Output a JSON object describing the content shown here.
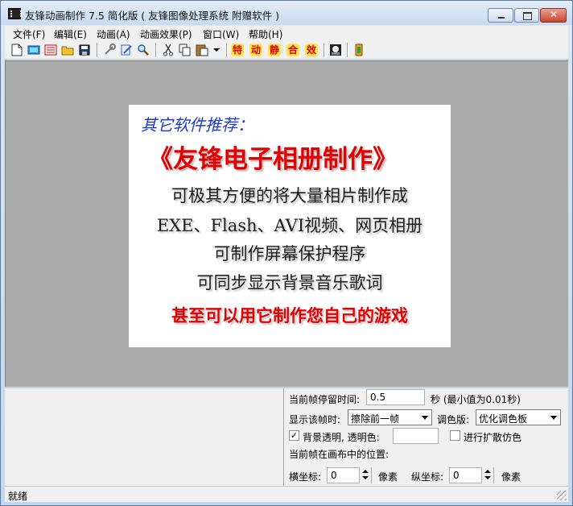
{
  "window": {
    "title": "友锋动画制作 7.5 简化版  ( 友锋图像处理系统 附赠软件 )",
    "icon": "film-strip-icon"
  },
  "menu": [
    "文件(F)",
    "编辑(E)",
    "动画(A)",
    "动画效果(P)",
    "窗口(W)",
    "帮助(H)"
  ],
  "toolbar": {
    "text_buttons": [
      "特",
      "动",
      "静",
      "合",
      "效"
    ]
  },
  "promo": {
    "heading": "其它软件推荐：",
    "product": "《友锋电子相册制作》",
    "lines": [
      "可极其方便的将大量相片制作成",
      "EXE、Flash、AVI视频、网页相册",
      "可制作屏幕保护程序",
      "可同步显示背景音乐歌词"
    ],
    "highlight": "甚至可以用它制作您自己的游戏"
  },
  "frame_props": {
    "dwell_label": "当前帧停留时间:",
    "dwell_value": "0.5",
    "dwell_unit": "秒 (最小值为0.01秒)",
    "display_label": "显示该帧时:",
    "display_value": "擦除前一帧",
    "palette_label": "调色版:",
    "palette_value": "优化调色板",
    "transparent_checked": true,
    "transparent_label": "背景透明, 透明色:",
    "dither_checked": false,
    "dither_label": "进行扩散仿色",
    "position_label": "当前帧在画布中的位置:",
    "x_label": "横坐标:",
    "x_value": "0",
    "x_unit": "像素",
    "y_label": "纵坐标:",
    "y_value": "0",
    "y_unit": "像素"
  },
  "status": {
    "text": "就绪"
  }
}
